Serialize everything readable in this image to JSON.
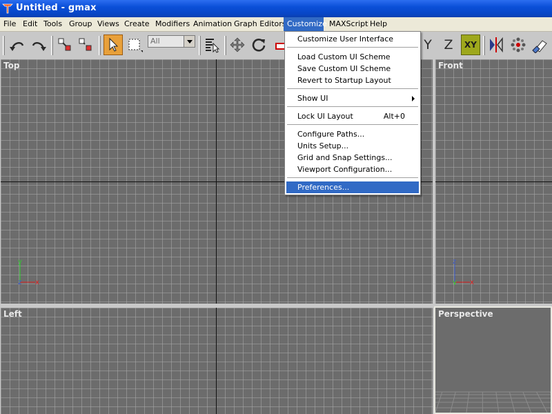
{
  "window": {
    "title": "Untitled - gmax"
  },
  "menubar": {
    "items": [
      {
        "label": "File"
      },
      {
        "label": "Edit"
      },
      {
        "label": "Tools"
      },
      {
        "label": "Group"
      },
      {
        "label": "Views"
      },
      {
        "label": "Create"
      },
      {
        "label": "Modifiers"
      },
      {
        "label": "Animation"
      },
      {
        "label": "Graph Editors"
      },
      {
        "label": "Customize"
      },
      {
        "label": "MAXScript"
      },
      {
        "label": "Help"
      }
    ],
    "active": "Customize"
  },
  "toolbar": {
    "selection_filter_value": "All",
    "axis_labels": {
      "y": "Y",
      "z": "Z",
      "xy": "XY"
    }
  },
  "customize_menu": {
    "items": [
      {
        "label": "Customize User Interface"
      },
      {
        "label": "Load Custom UI Scheme"
      },
      {
        "label": "Save Custom UI Scheme"
      },
      {
        "label": "Revert to Startup Layout"
      },
      {
        "label": "Show UI"
      },
      {
        "label": "Lock UI Layout",
        "shortcut": "Alt+0"
      },
      {
        "label": "Configure Paths..."
      },
      {
        "label": "Units Setup..."
      },
      {
        "label": "Grid and Snap Settings..."
      },
      {
        "label": "Viewport Configuration..."
      },
      {
        "label": "Preferences..."
      }
    ],
    "highlighted": "Preferences..."
  },
  "viewports": {
    "top": {
      "label": "Top"
    },
    "front": {
      "label": "Front"
    },
    "left": {
      "label": "Left"
    },
    "perspective": {
      "label": "Perspective"
    }
  },
  "axis_triad": {
    "x": "x",
    "y": "y",
    "z": "z"
  },
  "colors": {
    "titlebar": "#0a4fd8",
    "menu_highlight": "#316ac5",
    "viewport_bg": "#6c6c6c",
    "select_tool": "#e8a03a",
    "xy_constraint": "#9ea81c"
  }
}
